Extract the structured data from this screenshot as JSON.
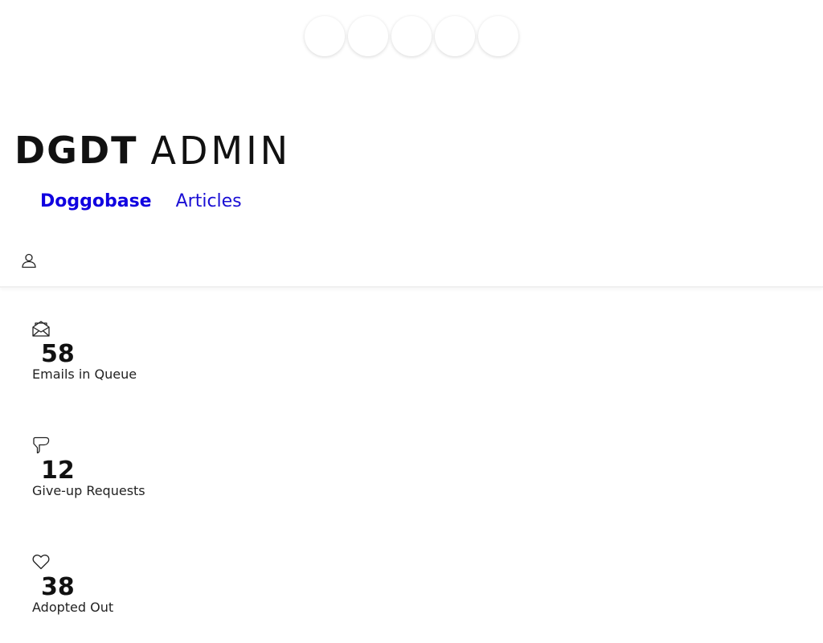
{
  "header": {
    "logo_bold": "DGDT",
    "logo_thin": "ADMIN"
  },
  "nav": {
    "items": [
      {
        "label": "Doggobase"
      },
      {
        "label": "Articles"
      }
    ]
  },
  "stats": [
    {
      "icon": "envelope-open-icon",
      "value": "58",
      "label": "Emails in Queue"
    },
    {
      "icon": "thumbs-down-icon",
      "value": "12",
      "label": "Give-up Requests"
    },
    {
      "icon": "heart-icon",
      "value": "38",
      "label": "Adopted Out"
    }
  ],
  "colors": {
    "nav_link": "#1a0fd4",
    "text": "#111111"
  }
}
